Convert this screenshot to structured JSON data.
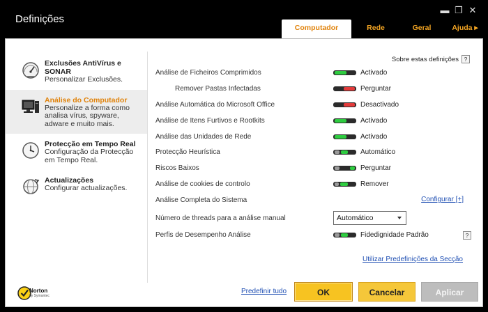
{
  "window": {
    "title": "Definições",
    "minimize_glyph": "▬",
    "maximize_glyph": "❐",
    "close_glyph": "✕"
  },
  "tabs": [
    {
      "label": "Computador",
      "active": true
    },
    {
      "label": "Rede",
      "active": false
    },
    {
      "label": "Geral",
      "active": false
    },
    {
      "label": "Ajuda ▸",
      "active": false
    }
  ],
  "sidebar": {
    "items": [
      {
        "icon": "gauge-icon",
        "title": "Exclusões AntiVírus e SONAR",
        "desc": "Personalizar Exclusões.",
        "active": false
      },
      {
        "icon": "computer-icon",
        "title": "Análise do Computador",
        "desc": "Personalize a forma como analisa vírus, spyware, adware e muito mais.",
        "active": true
      },
      {
        "icon": "clock-icon",
        "title": "Protecção em Tempo Real",
        "desc": "Configuração da Protecção em Tempo Real.",
        "active": false
      },
      {
        "icon": "globe-refresh-icon",
        "title": "Actualizações",
        "desc": "Configurar actualizações.",
        "active": false
      }
    ]
  },
  "help": {
    "label": "Sobre estas definições",
    "button": "?"
  },
  "settings": [
    {
      "label": "Análise de Ficheiros Comprimidos",
      "state": "Activado",
      "toggle": "on"
    },
    {
      "label": "Remover Pastas Infectadas",
      "state": "Perguntar",
      "toggle": "ask",
      "indent": true
    },
    {
      "label": "Análise Automática do Microsoft Office",
      "state": "Desactivado",
      "toggle": "off"
    },
    {
      "label": "Análise de Itens Furtivos e Rootkits",
      "state": "Activado",
      "toggle": "on"
    },
    {
      "label": "Análise das Unidades de Rede",
      "state": "Activado",
      "toggle": "on"
    },
    {
      "label": "Protecção Heurística",
      "state": "Automático",
      "toggle": "auto"
    },
    {
      "label": "Riscos Baixos",
      "state": "Perguntar",
      "toggle": "ask2"
    },
    {
      "label": "Análise de cookies de controlo",
      "state": "Remover",
      "toggle": "remove"
    },
    {
      "label": "Análise Completa do Sistema",
      "link": "Configurar [+]"
    },
    {
      "label": "Número de threads para a análise manual",
      "select": "Automático"
    },
    {
      "label": "Perfis de Desempenho Análise",
      "state": "Fidedignidade Padrão",
      "toggle": "auto",
      "help": "?"
    }
  ],
  "defaults_link": "Utilizar Predefinições da Secção",
  "footer": {
    "brand": "Norton",
    "brand_sub": "by Symantec",
    "reset_link": "Predefinir tudo",
    "ok": "OK",
    "cancel": "Cancelar",
    "apply": "Aplicar"
  },
  "colors": {
    "accent": "#e0820a",
    "tab_inactive": "#f5a623",
    "toggle_on": "#2ecc40",
    "toggle_off": "#e33b3b",
    "link": "#1f4fb3"
  }
}
